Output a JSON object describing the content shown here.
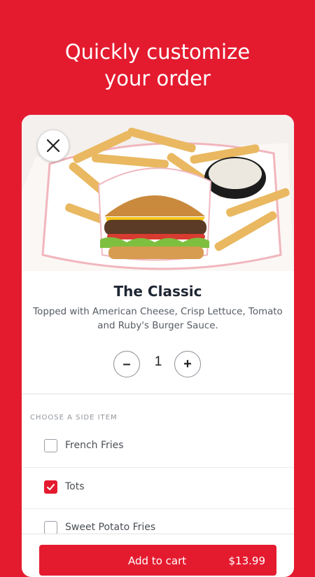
{
  "headline": {
    "line1": "Quickly customize",
    "line2": "your order"
  },
  "item": {
    "name": "The Classic",
    "description": "Topped with American Cheese, Crisp Lettuce, Tomato and Ruby's Burger Sauce."
  },
  "quantity": {
    "value": "1",
    "minus": "–",
    "plus": "+"
  },
  "side_section": {
    "label": "CHOOSE A SIDE ITEM",
    "options": [
      {
        "label": "French Fries",
        "checked": false
      },
      {
        "label": "Tots",
        "checked": true
      },
      {
        "label": "Sweet Potato Fries",
        "checked": false
      }
    ]
  },
  "cart": {
    "label": "Add to cart",
    "price": "$13.99"
  },
  "colors": {
    "brand": "#e41b2f"
  }
}
